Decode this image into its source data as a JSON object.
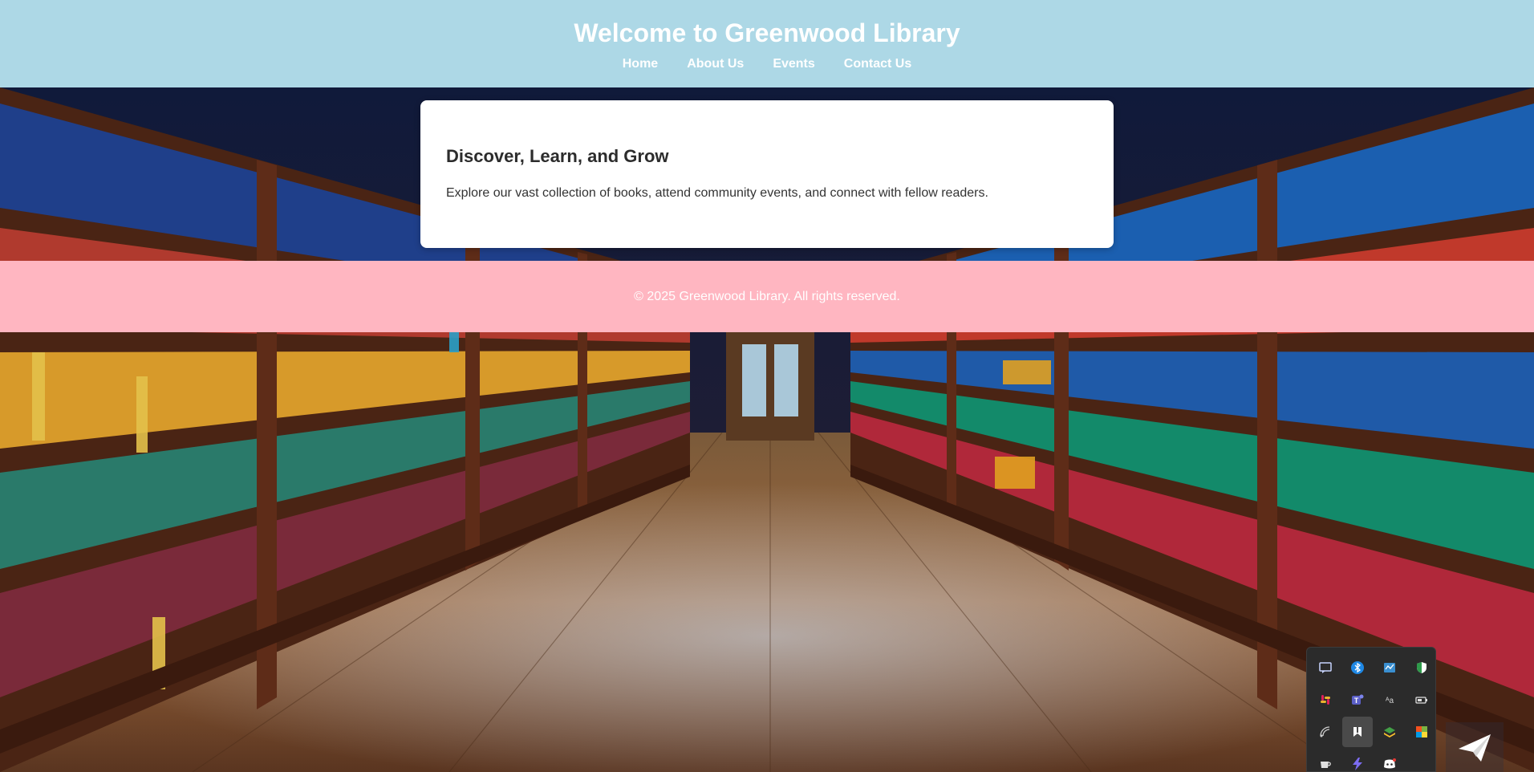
{
  "header": {
    "title": "Welcome to Greenwood Library",
    "nav": [
      {
        "label": "Home"
      },
      {
        "label": "About Us"
      },
      {
        "label": "Events"
      },
      {
        "label": "Contact Us"
      }
    ]
  },
  "hero": {
    "heading": "Discover, Learn, and Grow",
    "text": "Explore our vast collection of books, attend community events, and connect with fellow readers."
  },
  "footer": {
    "text": "© 2025 Greenwood Library. All rights reserved."
  },
  "colors": {
    "header_bg": "#add8e6",
    "footer_bg": "#ffb6c1",
    "card_bg": "#ffffff"
  },
  "tray": {
    "icons": [
      "chat-icon",
      "bluetooth-icon",
      "network-monitor-icon",
      "security-shield-icon",
      "slack-icon",
      "teams-icon",
      "text-tool-icon",
      "battery-icon",
      "wifi-icon",
      "bookmark-app-icon",
      "layers-app-icon",
      "color-picker-icon",
      "coffee-cup-icon",
      "bolt-app-icon",
      "discord-icon"
    ]
  }
}
